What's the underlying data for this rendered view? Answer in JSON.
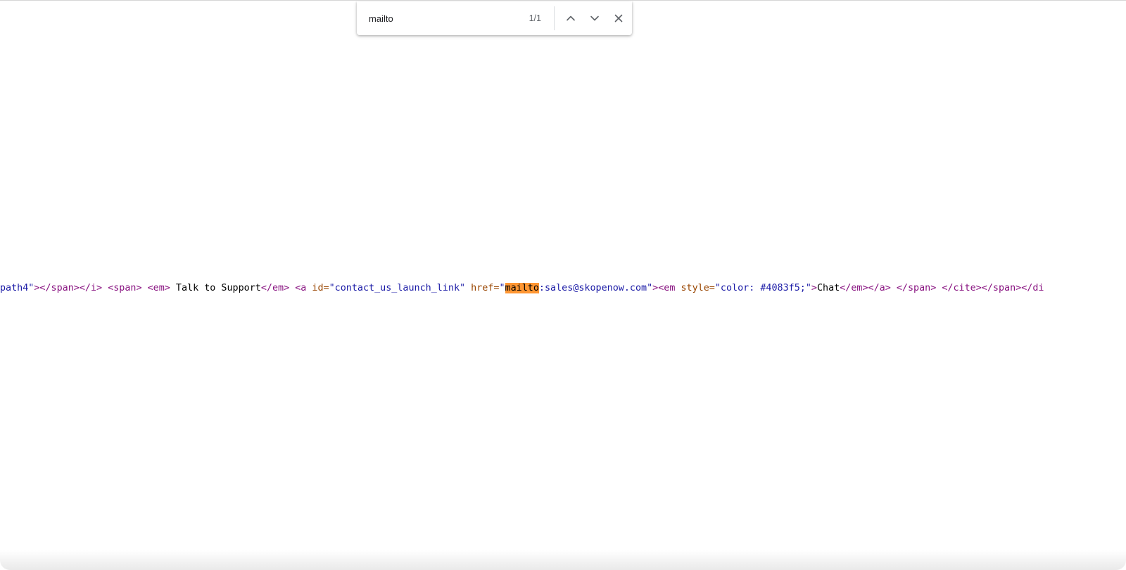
{
  "find_bar": {
    "query": "mailto",
    "match_count": "1/1",
    "previous_icon": "chevron-up",
    "next_icon": "chevron-down",
    "close_icon": "close"
  },
  "source": {
    "seg01": "path4\"",
    "seg02": "></span></i>",
    "seg03": " ",
    "seg04": "<span>",
    "seg05": " ",
    "seg06": "<em>",
    "seg07": " Talk to Support",
    "seg08": "</em>",
    "seg09": " ",
    "seg10": "<a",
    "seg11": " id=",
    "seg12": "\"contact_us_launch_link\"",
    "seg13": " href=",
    "seg14": "\"",
    "seg15": "mailto",
    "seg16": ":sales@skopenow.com\"",
    "seg17": "><em",
    "seg18": " style=",
    "seg19": "\"color: #4083f5;\"",
    "seg20": ">",
    "seg21": "Chat",
    "seg22": "</em></a>",
    "seg23": " ",
    "seg24": "</span>",
    "seg25": " ",
    "seg26": "</cite></span></di"
  },
  "colors": {
    "tag": "#881280",
    "attribute_name": "#994500",
    "attribute_value": "#1a1aa6",
    "text": "#000000",
    "find_highlight": "#ff9632"
  }
}
